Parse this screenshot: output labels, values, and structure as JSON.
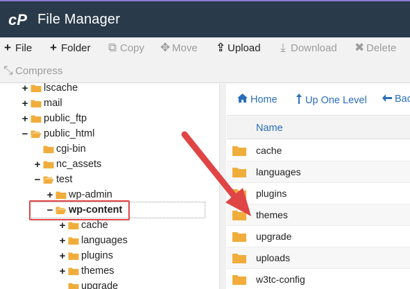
{
  "app": {
    "title": "File Manager"
  },
  "toolbar": {
    "row1": [
      {
        "icon": "plus-icon",
        "glyph": "+",
        "label": "File",
        "enabled": true
      },
      {
        "icon": "plus-icon",
        "glyph": "+",
        "label": "Folder",
        "enabled": true
      },
      {
        "icon": "copy-icon",
        "glyph": "⧉",
        "label": "Copy",
        "enabled": false
      },
      {
        "icon": "move-icon",
        "glyph": "✥",
        "label": "Move",
        "enabled": false
      },
      {
        "icon": "upload-icon",
        "glyph": "⇪",
        "label": "Upload",
        "enabled": true
      },
      {
        "icon": "download-icon",
        "glyph": "⤓",
        "label": "Download",
        "enabled": false
      },
      {
        "icon": "delete-icon",
        "glyph": "✖",
        "label": "Delete",
        "enabled": false
      }
    ],
    "row2": [
      {
        "icon": "compress-icon",
        "glyph": "⤡",
        "label": "Compress",
        "enabled": false
      }
    ]
  },
  "tree": {
    "items": [
      {
        "label": "lscache",
        "toggle": "+"
      },
      {
        "label": "mail",
        "toggle": "+"
      },
      {
        "label": "public_ftp",
        "toggle": "+"
      },
      {
        "label": "public_html",
        "toggle": "−"
      },
      {
        "label": "cgi-bin",
        "toggle": ""
      },
      {
        "label": "nc_assets",
        "toggle": "+"
      },
      {
        "label": "test",
        "toggle": "−"
      },
      {
        "label": "wp-admin",
        "toggle": "+"
      },
      {
        "label": "wp-content",
        "toggle": "−"
      },
      {
        "label": "cache",
        "toggle": "+"
      },
      {
        "label": "languages",
        "toggle": "+"
      },
      {
        "label": "plugins",
        "toggle": "+"
      },
      {
        "label": "themes",
        "toggle": "+"
      },
      {
        "label": "upgrade",
        "toggle": ""
      }
    ]
  },
  "navigation": {
    "home_label": "Home",
    "up_label": "Up One Level",
    "back_label": "Back"
  },
  "file_list": {
    "column_name": "Name",
    "rows": [
      "cache",
      "languages",
      "plugins",
      "themes",
      "upgrade",
      "uploads",
      "w3tc-config"
    ]
  },
  "colors": {
    "titlebar": "#293a4a",
    "folder": "#f0ad3c",
    "link": "#2a6ebb",
    "annotation": "#e04545"
  }
}
